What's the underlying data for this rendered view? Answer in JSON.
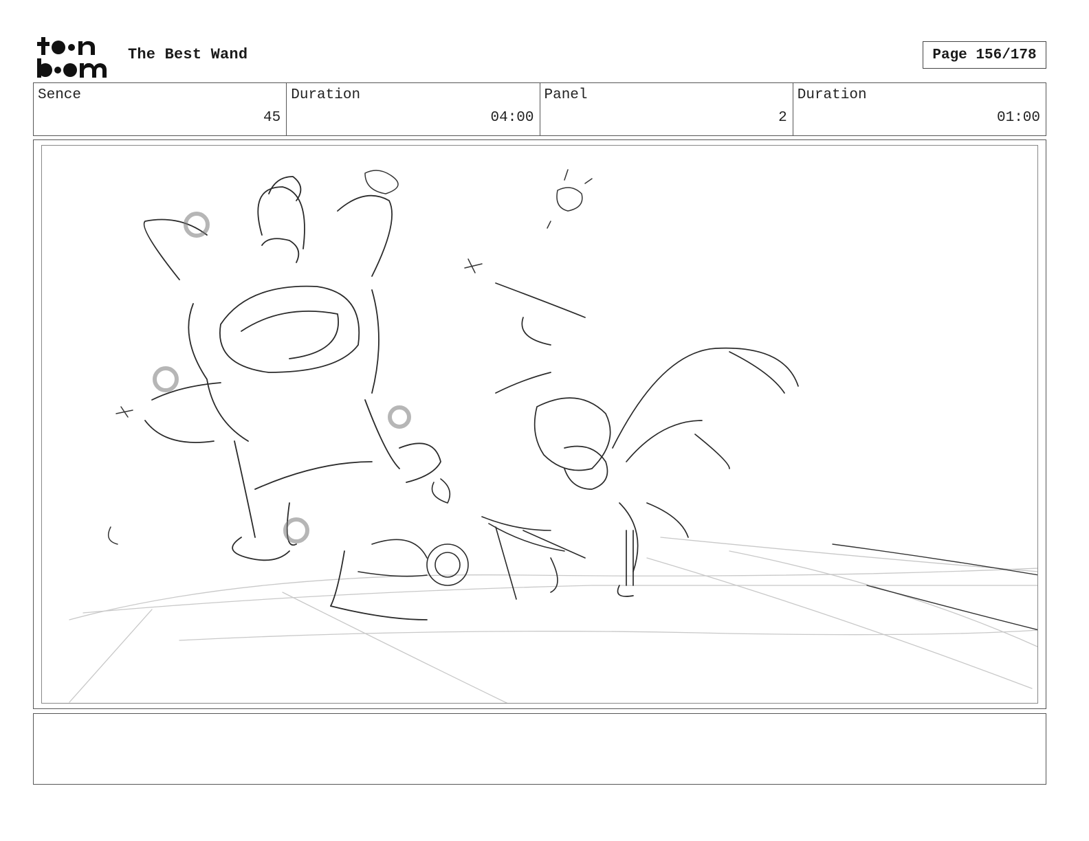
{
  "header": {
    "logo_text": "toon boom",
    "title": "The Best Wand",
    "page_label": "Page 156/178"
  },
  "info": [
    {
      "label": "Sence",
      "value": "45"
    },
    {
      "label": "Duration",
      "value": "04:00"
    },
    {
      "label": "Panel",
      "value": "2"
    },
    {
      "label": "Duration",
      "value": "01:00"
    }
  ],
  "panel": {
    "icon": "storyboard-sketch-image"
  },
  "notes": {
    "text": ""
  }
}
